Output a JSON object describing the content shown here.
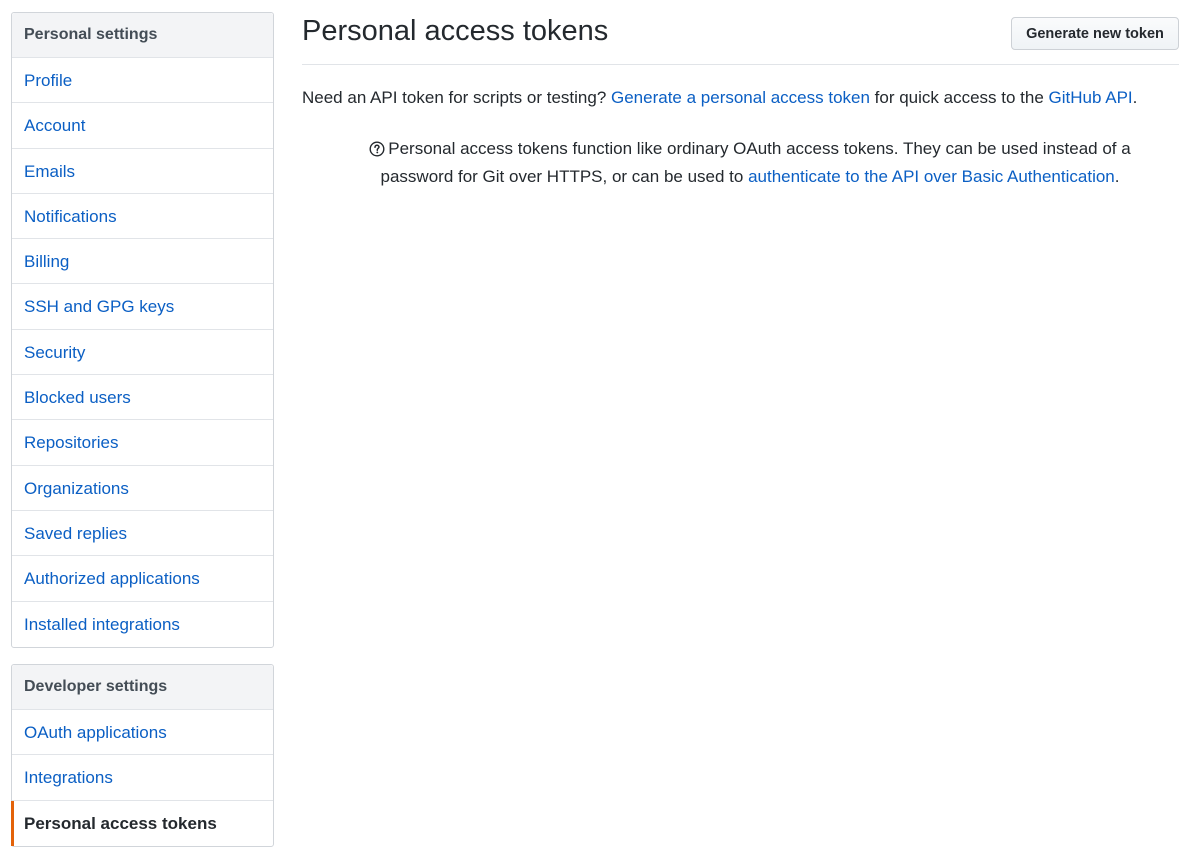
{
  "sidebar": {
    "personal": {
      "heading": "Personal settings",
      "items": [
        {
          "label": "Profile"
        },
        {
          "label": "Account"
        },
        {
          "label": "Emails"
        },
        {
          "label": "Notifications"
        },
        {
          "label": "Billing"
        },
        {
          "label": "SSH and GPG keys"
        },
        {
          "label": "Security"
        },
        {
          "label": "Blocked users"
        },
        {
          "label": "Repositories"
        },
        {
          "label": "Organizations"
        },
        {
          "label": "Saved replies"
        },
        {
          "label": "Authorized applications"
        },
        {
          "label": "Installed integrations"
        }
      ]
    },
    "developer": {
      "heading": "Developer settings",
      "items": [
        {
          "label": "OAuth applications",
          "selected": false
        },
        {
          "label": "Integrations",
          "selected": false
        },
        {
          "label": "Personal access tokens",
          "selected": true
        }
      ]
    }
  },
  "main": {
    "title": "Personal access tokens",
    "generate_button": "Generate new token",
    "intro": {
      "text1": "Need an API token for scripts or testing? ",
      "link1": "Generate a personal access token",
      "text2": " for quick access to the ",
      "link2": "GitHub API",
      "text3": "."
    },
    "note": {
      "text1": "Personal access tokens function like ordinary OAuth access tokens. They can be used instead of a password for Git over HTTPS, or can be used to ",
      "link": "authenticate to the API over Basic Authentication",
      "text2": "."
    }
  },
  "colors": {
    "link": "#0b5fc4",
    "selected_accent": "#e36209",
    "heading_bg": "#f3f4f6"
  },
  "icons": {
    "note_icon": "question-circle-icon"
  }
}
